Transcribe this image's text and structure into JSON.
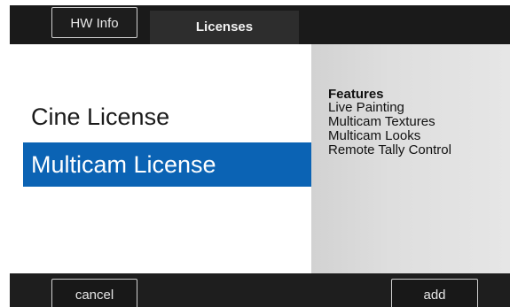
{
  "header": {
    "hw_info_tab": "HW Info",
    "title": "Licenses"
  },
  "licenses": {
    "items": [
      {
        "label": "Cine License",
        "selected": false
      },
      {
        "label": "Multicam License",
        "selected": true
      }
    ]
  },
  "features": {
    "heading": "Features",
    "items": [
      "Live Painting",
      "Multicam Textures",
      "Multicam Looks",
      "Remote Tally Control"
    ]
  },
  "footer": {
    "cancel_label": "cancel",
    "add_label": "add"
  },
  "colors": {
    "selection": "#0b63b4",
    "bar_background": "#1a1a1a"
  }
}
